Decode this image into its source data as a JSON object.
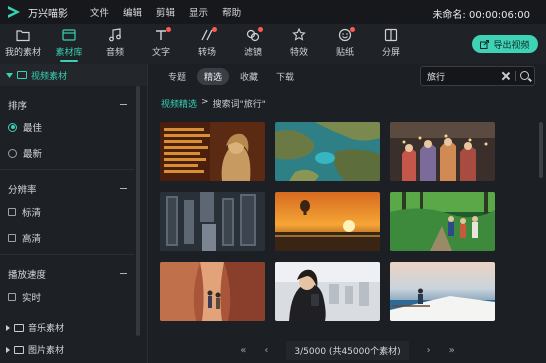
{
  "app": {
    "name": "万兴喵影",
    "project_title": "未命名: 00:00:06:00"
  },
  "menu": [
    "文件",
    "编辑",
    "剪辑",
    "显示",
    "帮助"
  ],
  "toolbar": {
    "tools": [
      {
        "label": "我的素材",
        "icon": "folder-icon",
        "active": false,
        "dot": false
      },
      {
        "label": "素材库",
        "icon": "library-icon",
        "active": true,
        "dot": false
      },
      {
        "label": "音频",
        "icon": "music-note-icon",
        "active": false,
        "dot": false
      },
      {
        "label": "文字",
        "icon": "text-icon",
        "active": false,
        "dot": true
      },
      {
        "label": "转场",
        "icon": "transition-icon",
        "active": false,
        "dot": true
      },
      {
        "label": "滤镜",
        "icon": "filter-icon",
        "active": false,
        "dot": true
      },
      {
        "label": "特效",
        "icon": "effects-icon",
        "active": false,
        "dot": false
      },
      {
        "label": "贴纸",
        "icon": "sticker-icon",
        "active": false,
        "dot": true
      },
      {
        "label": "分屏",
        "icon": "split-screen-icon",
        "active": false,
        "dot": false
      }
    ],
    "export_label": "导出视频"
  },
  "sidebar": {
    "header": "视频素材",
    "sort": {
      "title": "排序",
      "options": [
        {
          "label": "最佳",
          "selected": true
        },
        {
          "label": "最新",
          "selected": false
        }
      ]
    },
    "resolution": {
      "title": "分辨率",
      "options": [
        {
          "label": "标清",
          "checked": false
        },
        {
          "label": "高清",
          "checked": false
        }
      ]
    },
    "speed": {
      "title": "播放速度",
      "options": [
        {
          "label": "实时",
          "checked": false
        }
      ]
    },
    "folders": [
      "音乐素材",
      "图片素材"
    ]
  },
  "main": {
    "tabs": [
      {
        "label": "专题",
        "active": false
      },
      {
        "label": "精选",
        "active": true
      },
      {
        "label": "收藏",
        "active": false
      },
      {
        "label": "下载",
        "active": false
      }
    ],
    "search": {
      "value": "旅行",
      "placeholder": ""
    },
    "breadcrumb": {
      "root": "视频精选",
      "sep": ">",
      "current": "搜索词\"旅行\""
    },
    "thumbnails": [
      {
        "name": "departure-board"
      },
      {
        "name": "aerial-islands"
      },
      {
        "name": "costumed-performers"
      },
      {
        "name": "aerial-city"
      },
      {
        "name": "sunset-balloon"
      },
      {
        "name": "forest-hikers"
      },
      {
        "name": "canyon-hikers"
      },
      {
        "name": "woman-phone-airport"
      },
      {
        "name": "boat-ocean"
      }
    ],
    "pager": {
      "first": "«",
      "prev": "‹",
      "info": "3/5000 (共45000个素材)",
      "next": "›",
      "last": "»"
    }
  },
  "colors": {
    "accent": "#37d1b5",
    "dot": "#ff5a4e",
    "bg": "#1c1f24"
  }
}
